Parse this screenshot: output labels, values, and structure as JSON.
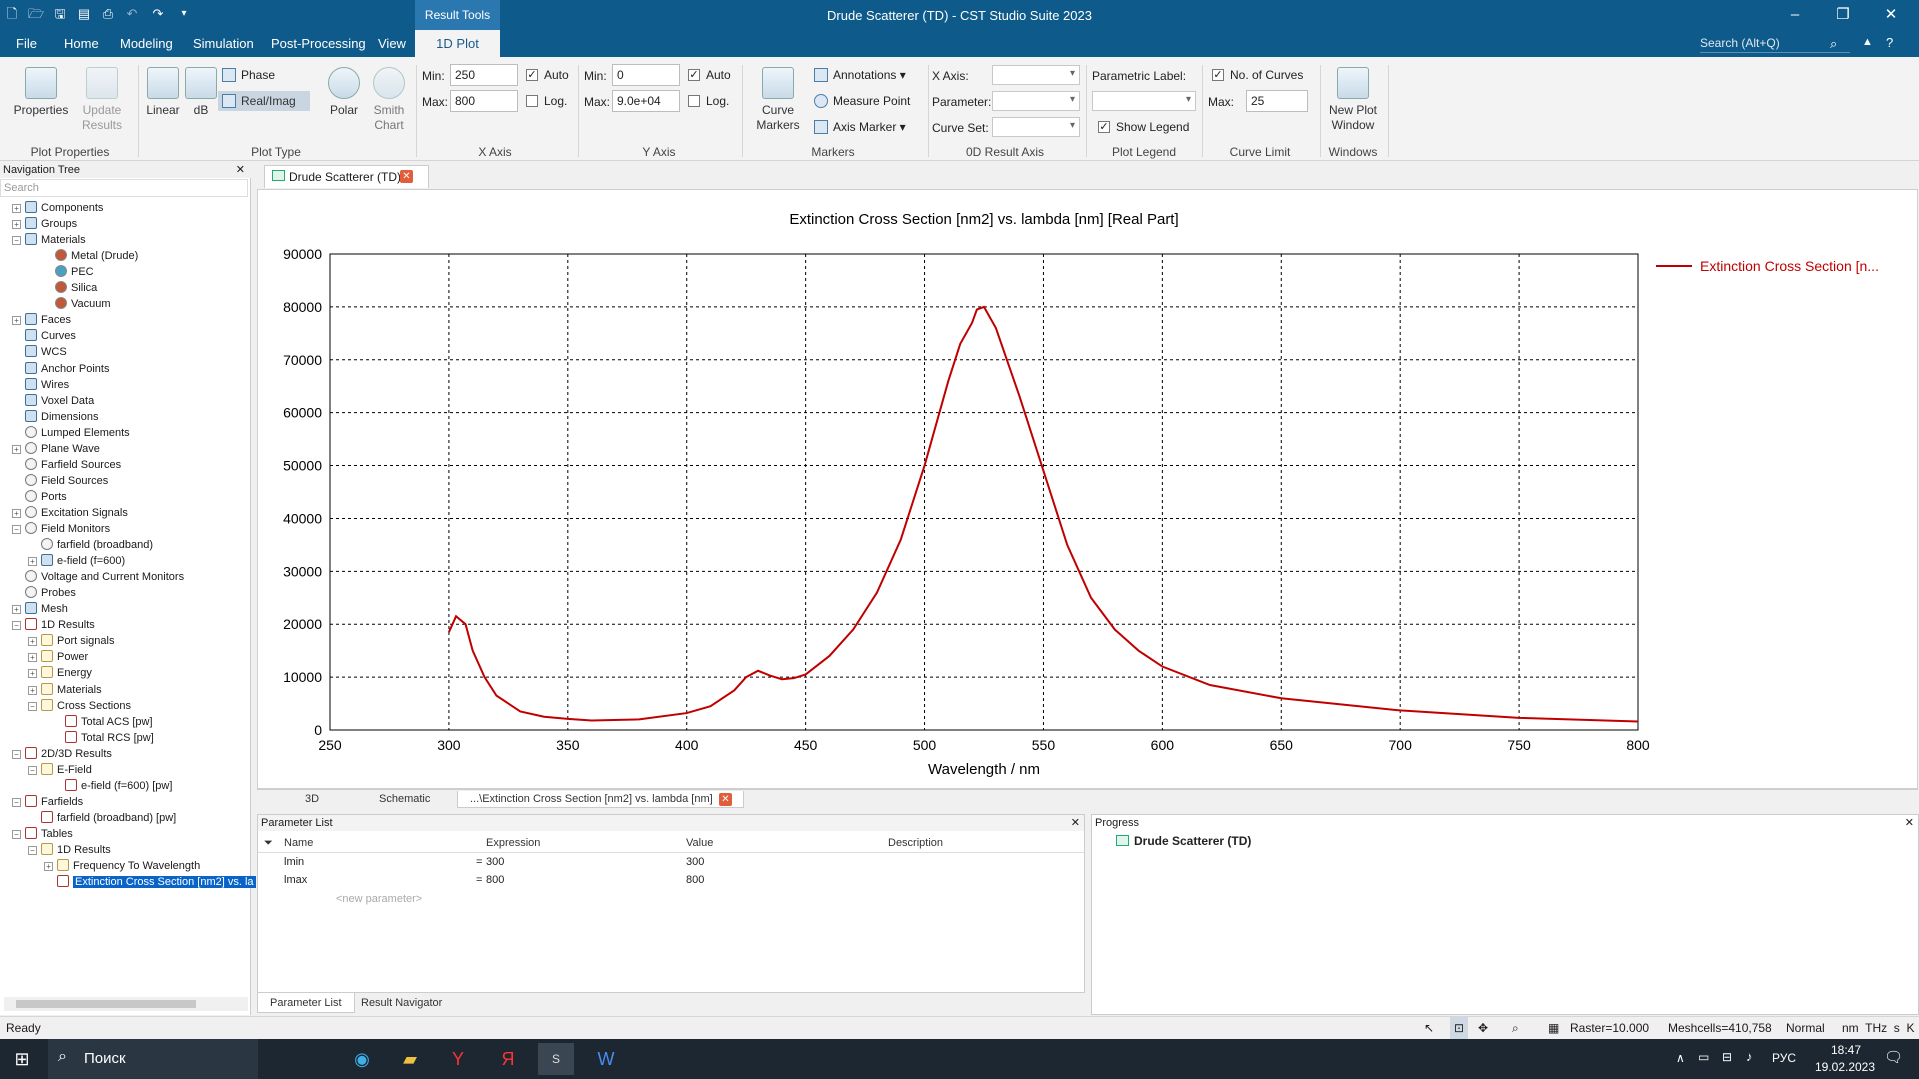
{
  "window": {
    "title": "Drude Scatterer (TD) - CST Studio Suite 2023",
    "context_group": "Result Tools"
  },
  "menu": [
    "File",
    "Home",
    "Modeling",
    "Simulation",
    "Post-Processing",
    "View",
    "1D Plot"
  ],
  "search_placeholder": "Search (Alt+Q)",
  "ribbon": {
    "properties": "Properties",
    "update_results_1": "Update",
    "update_results_2": "Results",
    "linear": "Linear",
    "db": "dB",
    "phase": "Phase",
    "real_imag": "Real/Imag",
    "polar": "Polar",
    "smith_1": "Smith",
    "smith_2": "Chart",
    "x_min_label": "Min:",
    "x_min": "250",
    "x_max_label": "Max:",
    "x_max": "800",
    "x_auto": "Auto",
    "x_log": "Log.",
    "y_min_label": "Min:",
    "y_min": "0",
    "y_max_label": "Max:",
    "y_max": "9.0e+04",
    "y_auto": "Auto",
    "y_log": "Log.",
    "curve_markers_1": "Curve",
    "curve_markers_2": "Markers",
    "annotations": "Annotations",
    "measure_point": "Measure Point",
    "axis_marker": "Axis Marker",
    "x_axis": "X Axis:",
    "parameter": "Parameter:",
    "curve_set": "Curve Set:",
    "parametric_label": "Parametric Label:",
    "show_legend": "Show Legend",
    "no_of_curves": "No. of Curves",
    "curve_max_label": "Max:",
    "curve_max": "25",
    "new_plot_1": "New Plot",
    "new_plot_2": "Window",
    "groups": [
      "Plot Properties",
      "Plot Type",
      "X Axis",
      "Y Axis",
      "Markers",
      "0D Result Axis",
      "Plot Legend",
      "Curve Limit",
      "Windows"
    ]
  },
  "nav": {
    "title": "Navigation Tree",
    "search": "Search",
    "items": [
      {
        "label": "Components"
      },
      {
        "label": "Groups"
      },
      {
        "label": "Materials"
      },
      {
        "label": "Metal (Drude)"
      },
      {
        "label": "PEC"
      },
      {
        "label": "Silica"
      },
      {
        "label": "Vacuum"
      },
      {
        "label": "Faces"
      },
      {
        "label": "Curves"
      },
      {
        "label": "WCS"
      },
      {
        "label": "Anchor Points"
      },
      {
        "label": "Wires"
      },
      {
        "label": "Voxel Data"
      },
      {
        "label": "Dimensions"
      },
      {
        "label": "Lumped Elements"
      },
      {
        "label": "Plane Wave"
      },
      {
        "label": "Farfield Sources"
      },
      {
        "label": "Field Sources"
      },
      {
        "label": "Ports"
      },
      {
        "label": "Excitation Signals"
      },
      {
        "label": "Field Monitors"
      },
      {
        "label": "farfield (broadband)"
      },
      {
        "label": "e-field (f=600)"
      },
      {
        "label": "Voltage and Current Monitors"
      },
      {
        "label": "Probes"
      },
      {
        "label": "Mesh"
      },
      {
        "label": "1D Results"
      },
      {
        "label": "Port signals"
      },
      {
        "label": "Power"
      },
      {
        "label": "Energy"
      },
      {
        "label": "Materials"
      },
      {
        "label": "Cross Sections"
      },
      {
        "label": "Total ACS [pw]"
      },
      {
        "label": "Total RCS [pw]"
      },
      {
        "label": "2D/3D Results"
      },
      {
        "label": "E-Field"
      },
      {
        "label": "e-field (f=600) [pw]"
      },
      {
        "label": "Farfields"
      },
      {
        "label": "farfield (broadband) [pw]"
      },
      {
        "label": "Tables"
      },
      {
        "label": "1D Results"
      },
      {
        "label": "Frequency To Wavelength"
      },
      {
        "label": "Extinction Cross Section [nm2] vs. la"
      }
    ]
  },
  "doc_tab": "Drude Scatterer (TD)*",
  "bottom_tabs": [
    "3D",
    "Schematic",
    "...\\Extinction Cross Section [nm2] vs. lambda [nm]"
  ],
  "parameters": {
    "title": "Parameter List",
    "cols": [
      "Name",
      "Expression",
      "Value",
      "Description"
    ],
    "rows": [
      {
        "name": "lmin",
        "eq": "=",
        "expr": "300",
        "value": "300"
      },
      {
        "name": "lmax",
        "eq": "=",
        "expr": "800",
        "value": "800"
      }
    ],
    "new_param": "<new parameter>",
    "tabs": [
      "Parameter List",
      "Result Navigator"
    ]
  },
  "progress": {
    "title": "Progress",
    "item": "Drude Scatterer (TD)"
  },
  "status": {
    "ready": "Ready",
    "raster": "Raster=10.000",
    "meshcells": "Meshcells=410,758",
    "mode": "Normal",
    "units": "nm  THz  s  K"
  },
  "taskbar": {
    "search": "Поиск",
    "lang": "РУС",
    "time": "18:47",
    "date": "19.02.2023"
  },
  "chart_data": {
    "type": "line",
    "title": "Extinction Cross Section [nm2] vs. lambda [nm] [Real Part]",
    "xlabel": "Wavelength / nm",
    "ylabel": "",
    "xlim": [
      250,
      800
    ],
    "ylim": [
      0,
      90000
    ],
    "xticks": [
      250,
      300,
      350,
      400,
      450,
      500,
      550,
      600,
      650,
      700,
      750,
      800
    ],
    "yticks": [
      0,
      10000,
      20000,
      30000,
      40000,
      50000,
      60000,
      70000,
      80000,
      90000
    ],
    "grid": true,
    "legend_position": "right",
    "series": [
      {
        "name": "Extinction Cross Section [n...",
        "color": "#c00000",
        "x": [
          300,
          303,
          307,
          310,
          315,
          320,
          330,
          340,
          350,
          360,
          380,
          400,
          410,
          420,
          425,
          430,
          435,
          440,
          445,
          450,
          460,
          470,
          480,
          490,
          500,
          510,
          515,
          520,
          522,
          525,
          530,
          540,
          550,
          560,
          570,
          580,
          590,
          600,
          620,
          650,
          700,
          750,
          800
        ],
        "y": [
          18500,
          21500,
          20000,
          15000,
          10000,
          6500,
          3500,
          2500,
          2100,
          1800,
          2000,
          3200,
          4500,
          7500,
          10000,
          11200,
          10300,
          9600,
          9800,
          10500,
          14000,
          19000,
          26000,
          36000,
          50000,
          66000,
          73000,
          77000,
          79500,
          80000,
          76000,
          63000,
          49000,
          35000,
          25000,
          19000,
          15000,
          12000,
          8500,
          6000,
          3700,
          2300,
          1600
        ]
      }
    ]
  }
}
